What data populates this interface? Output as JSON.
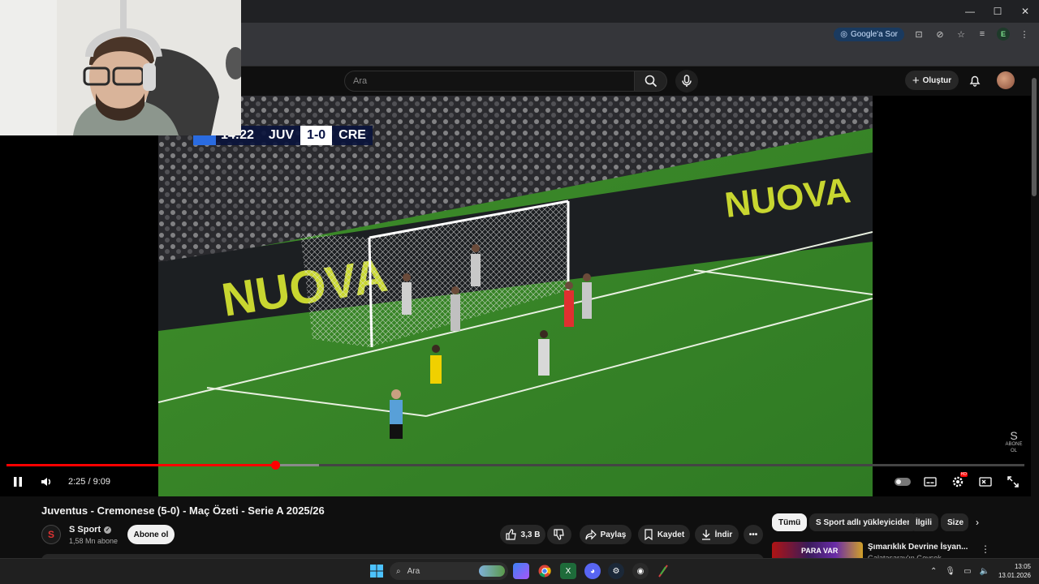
{
  "browser": {
    "ask_google_label": "Google'a Sor",
    "profile_initial": "E",
    "window_controls": [
      "—",
      "☐",
      "✕"
    ]
  },
  "youtube_header": {
    "search_placeholder": "Ara",
    "create_label": "Oluştur"
  },
  "player": {
    "scoreboard": {
      "time": "14:22",
      "home": "JUV",
      "score": "1-0",
      "away": "CRE"
    },
    "channel_watermark": "ABONE OL",
    "current_time": "2:25",
    "duration": "9:09",
    "time_display": "2:25 / 9:09",
    "progress_fraction": 0.264,
    "buffered_fraction": 0.307,
    "stadium_text": "NUOVA"
  },
  "video_info": {
    "title": "Juventus - Cremonese (5-0) - Maç Özeti - Serie A 2025/26",
    "channel_name": "S Sport",
    "channel_initial": "S",
    "subscribers": "1,58 Mn abone",
    "subscribe_label": "Abone ol",
    "like_count": "3,3 B",
    "share_label": "Paylaş",
    "save_label": "Kaydet",
    "download_label": "İndir"
  },
  "recommendations": {
    "chips": [
      "Tümü",
      "S Sport adlı yükleyiciden",
      "İlgili",
      "Size"
    ],
    "first_item": {
      "title": "Şımarıklık Devrine İsyan...",
      "subtitle": "Galatasaray'ın Gevşek...",
      "thumb_text": "PARA VAR"
    }
  },
  "taskbar": {
    "search_placeholder": "Ara",
    "clock_time": "13:05",
    "clock_date": "13.01.2026"
  },
  "colors": {
    "progress_played": "#ff0000",
    "youtube_bg": "#0f0f0f",
    "scoreboard_bg": "#0a143c"
  }
}
